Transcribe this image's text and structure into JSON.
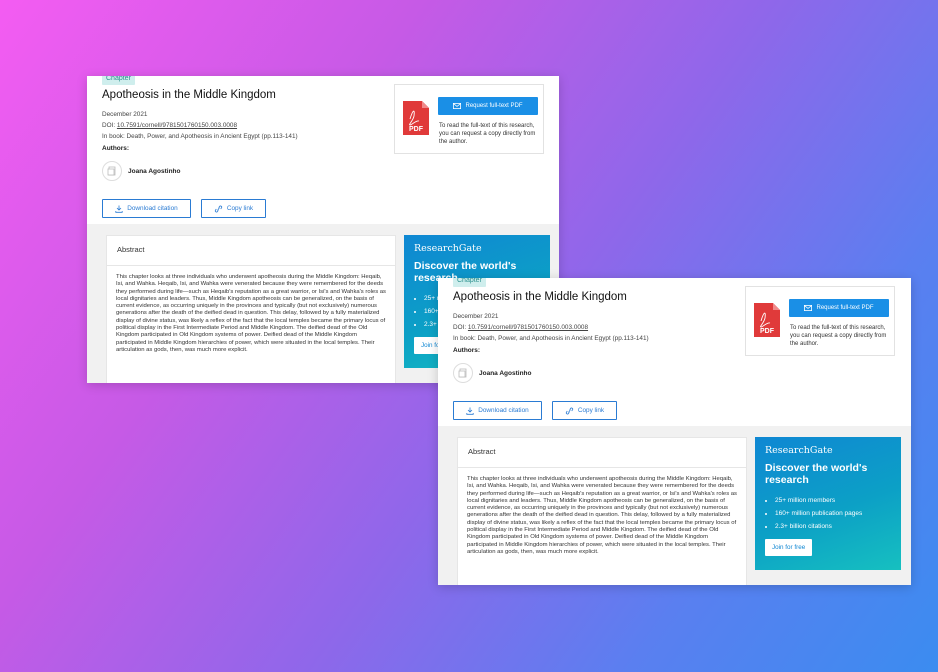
{
  "chapter": {
    "tag": "Chapter",
    "title": "Apotheosis in the Middle Kingdom",
    "date": "December 2021",
    "doi_prefix": "DOI:",
    "doi": "10.7591/cornell/9781501760150.003.0008",
    "book": "In book: Death, Power, and Apotheosis in Ancient Egypt (pp.113-141)",
    "authors_label": "Authors:",
    "author_name": "Joana Agostinho"
  },
  "actions": {
    "download_citation": "Download citation",
    "copy_link": "Copy link"
  },
  "pdf_request": {
    "button_label": "Request full-text PDF",
    "description": "To read the full-text of this research, you can request a copy directly from the author."
  },
  "abstract": {
    "heading": "Abstract",
    "text": "This chapter looks at three individuals who underwent apotheosis during the Middle Kingdom: Heqaib, Isi, and Wahka. Heqaib, Isi, and Wahka were venerated because they were remembered for the deeds they performed during life—such as Heqaib's reputation as a great warrior, or Isi's and Wahka's roles as local dignitaries and leaders. Thus, Middle Kingdom apotheosis can be generalized, on the basis of current evidence, as occurring uniquely in the provinces and typically (but not exclusively) numerous generations after the death of the deified dead in question. This delay, followed by a fully materialized display of divine status, was likely a reflex of the fact that the local temples became the primary locus of political display in the First Intermediate Period and Middle Kingdom. The deified dead of the Old Kingdom participated in Old Kingdom systems of power. Deified dead of the Middle Kingdom participated in Middle Kingdom hierarchies of power, which were situated in the local temples. Their articulation as gods, then, was much more explicit."
  },
  "rg_ad": {
    "logo": "ResearchGate",
    "headline": "Discover the world's research",
    "items": [
      "25+ million members",
      "160+ million publication pages",
      "2.3+ billion citations"
    ],
    "join_label": "Join for free"
  },
  "colors": {
    "accent": "#1a8fe6",
    "tag_bg": "#cfeeed",
    "pdf_red": "#e03a3a"
  }
}
